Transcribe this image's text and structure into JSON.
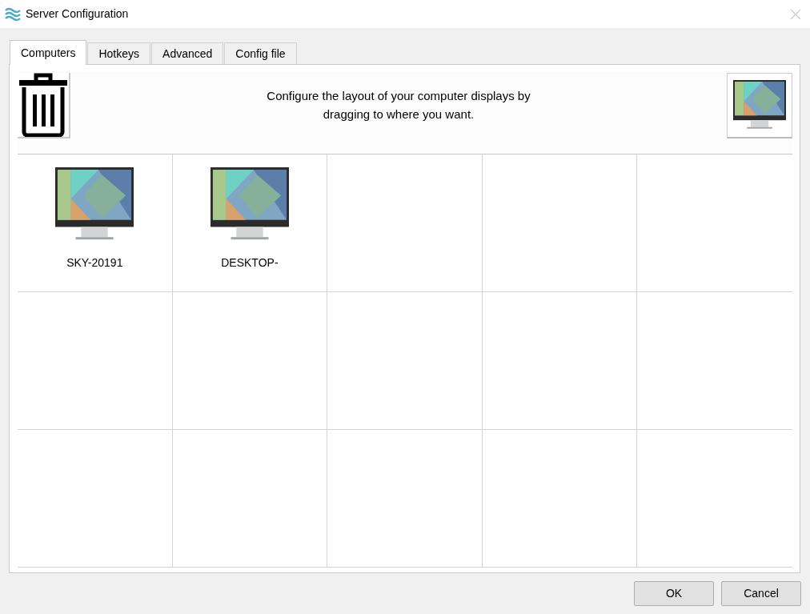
{
  "window": {
    "title": "Server Configuration"
  },
  "tabs": [
    {
      "label": "Computers",
      "selected": true
    },
    {
      "label": "Hotkeys",
      "selected": false
    },
    {
      "label": "Advanced",
      "selected": false
    },
    {
      "label": "Config file",
      "selected": false
    }
  ],
  "instructions": "Configure the layout of your computer displays by dragging to where you want.",
  "grid": {
    "rows": [
      {
        "cells": [
          {
            "kind": "computer",
            "name": "SKY-20191"
          },
          {
            "kind": "computer",
            "name": "DESKTOP-"
          },
          {
            "kind": "empty"
          },
          {
            "kind": "empty"
          },
          {
            "kind": "empty"
          }
        ]
      },
      {
        "cells": [
          {
            "kind": "empty"
          },
          {
            "kind": "empty"
          },
          {
            "kind": "empty"
          },
          {
            "kind": "empty"
          },
          {
            "kind": "empty"
          }
        ]
      },
      {
        "cells": [
          {
            "kind": "empty"
          },
          {
            "kind": "empty"
          },
          {
            "kind": "empty"
          },
          {
            "kind": "empty"
          },
          {
            "kind": "empty"
          }
        ]
      }
    ]
  },
  "buttons": [
    {
      "label": "OK"
    },
    {
      "label": "Cancel"
    }
  ]
}
